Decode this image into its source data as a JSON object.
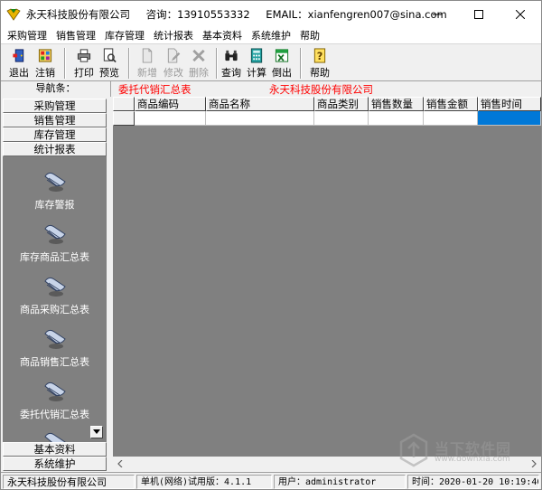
{
  "titlebar": {
    "company": "永天科技股份有限公司",
    "consult": "咨询：13910553332",
    "email": "EMAIL：xianfengren007@sina.com"
  },
  "menu": [
    "采购管理",
    "销售管理",
    "库存管理",
    "统计报表",
    "基本资料",
    "系统维护",
    "帮助"
  ],
  "toolbar": {
    "exit": "退出",
    "logout": "注销",
    "print": "打印",
    "preview": "预览",
    "add": "新增",
    "edit": "修改",
    "delete": "删除",
    "query": "查询",
    "calc": "计算",
    "export": "倒出",
    "help": "帮助"
  },
  "nav": {
    "label": "导航条：",
    "report_title": "委托代销汇总表",
    "report_company": "永天科技股份有限公司",
    "top_groups": [
      "采购管理",
      "销售管理",
      "库存管理",
      "统计报表"
    ],
    "bottom_groups": [
      "基本资料",
      "系统维护"
    ],
    "panel_items": [
      "库存警报",
      "库存商品汇总表",
      "商品采购汇总表",
      "商品销售汇总表",
      "委托代销汇总表"
    ]
  },
  "grid": {
    "columns": [
      "",
      "商品编码",
      "商品名称",
      "商品类别",
      "销售数量",
      "销售金额",
      "销售时间"
    ]
  },
  "status": {
    "company": "永天科技股份有限公司",
    "edition": "单机(网络)试用版：4.1.1",
    "user": "用户：administrator",
    "time": "时间：2020-01-20 10:19:46"
  },
  "watermark": {
    "text": "当下软件园",
    "url": "www.downxia.com"
  },
  "colors": {
    "selection": "#0078d7",
    "report_red": "#ff0000",
    "panel_bg": "#808080"
  }
}
